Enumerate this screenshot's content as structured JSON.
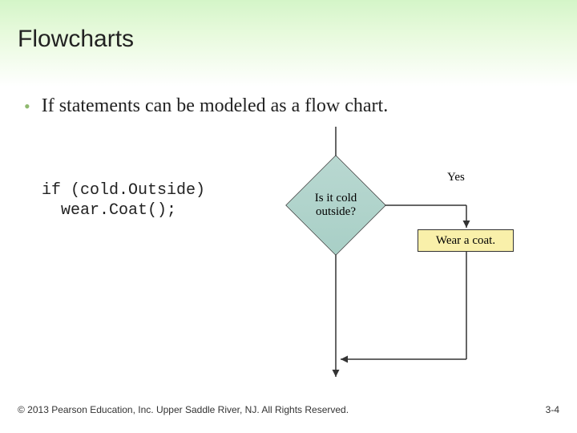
{
  "title": "Flowcharts",
  "bullet": "If statements can be modeled as a flow chart.",
  "code": {
    "line1": "if (cold.Outside)",
    "line2": "  wear.Coat();"
  },
  "flow": {
    "decision": "Is it cold\noutside?",
    "yes_label": "Yes",
    "action": "Wear a coat."
  },
  "footer": "© 2013 Pearson Education, Inc. Upper Saddle River, NJ. All Rights Reserved.",
  "page_number": "3-4"
}
